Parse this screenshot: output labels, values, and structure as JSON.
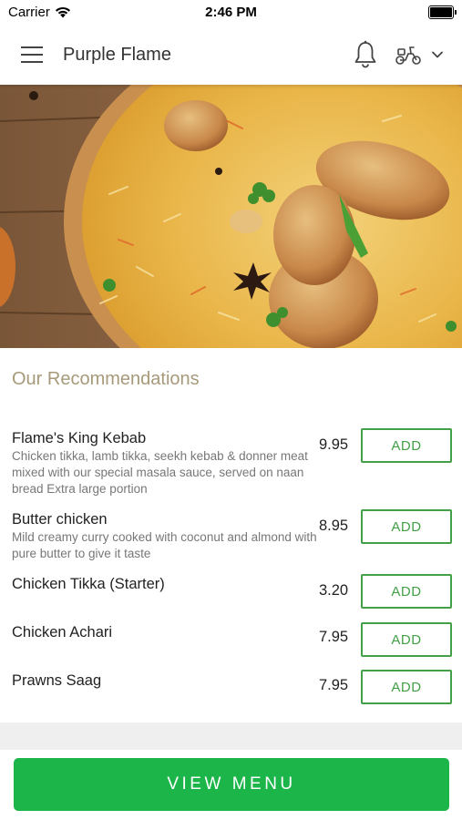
{
  "status_bar": {
    "carrier": "Carrier",
    "time": "2:46 PM"
  },
  "header": {
    "title": "Purple Flame",
    "icons": [
      "hamburger-menu-icon",
      "bell-icon",
      "scooter-icon",
      "chevron-down-icon"
    ]
  },
  "hero": {
    "image": "biryani-plate-photo"
  },
  "recommendations": {
    "title": "Our Recommendations",
    "add_label": "ADD",
    "items": [
      {
        "name": "Flame's King Kebab",
        "description": "Chicken tikka, lamb tikka, seekh kebab & donner meat mixed with our special masala sauce, served on naan bread Extra large portion",
        "price": "9.95"
      },
      {
        "name": "Butter chicken",
        "description": "Mild creamy curry cooked with coconut and almond with pure butter to give it taste",
        "price": "8.95"
      },
      {
        "name": "Chicken Tikka (Starter)",
        "description": "",
        "price": "3.20"
      },
      {
        "name": "Chicken Achari",
        "description": "",
        "price": "7.95"
      },
      {
        "name": "Prawns Saag",
        "description": "",
        "price": "7.95"
      }
    ]
  },
  "footer": {
    "view_menu_label": "VIEW MENU"
  },
  "colors": {
    "accent_green": "#43a047",
    "button_green": "#1cb54a",
    "section_title": "#a79a7a"
  }
}
